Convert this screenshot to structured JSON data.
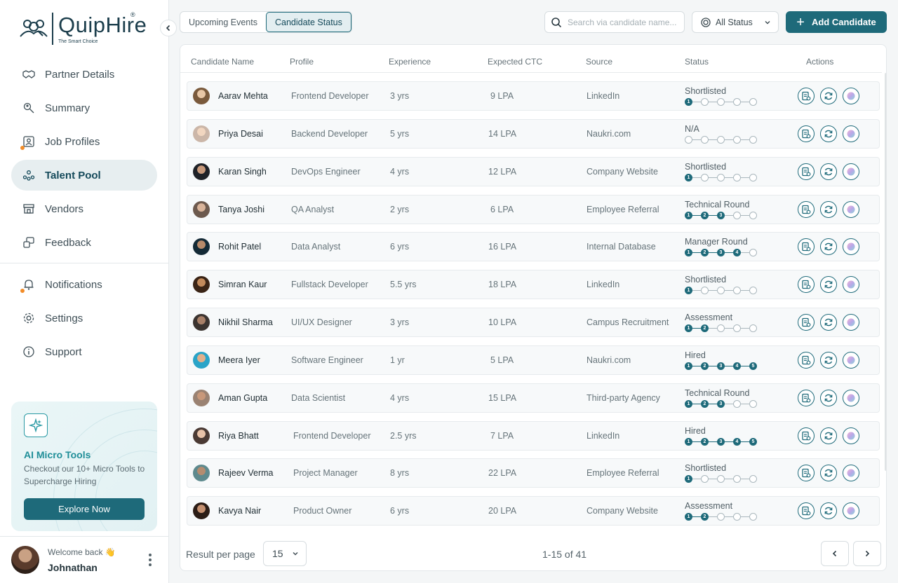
{
  "brand": {
    "name": "QuipHire",
    "tagline": "The Smart Choice",
    "reg": "®"
  },
  "nav_primary": [
    {
      "label": "Partner Details",
      "icon": "handshake-icon"
    },
    {
      "label": "Summary",
      "icon": "summary-icon"
    },
    {
      "label": "Job Profiles",
      "icon": "job-profile-icon",
      "badge": true
    },
    {
      "label": "Talent Pool",
      "icon": "talent-pool-icon",
      "active": true
    },
    {
      "label": "Vendors",
      "icon": "store-icon"
    },
    {
      "label": "Feedback",
      "icon": "feedback-icon"
    }
  ],
  "nav_secondary": [
    {
      "label": "Notifications",
      "icon": "bell-icon",
      "badge": true
    },
    {
      "label": "Settings",
      "icon": "gear-icon"
    },
    {
      "label": "Support",
      "icon": "info-icon"
    }
  ],
  "promo": {
    "title": "AI Micro Tools",
    "description": "Checkout our 10+ Micro Tools to Supercharge Hiring",
    "button": "Explore Now"
  },
  "user": {
    "welcome": "Welcome back 👋",
    "name": "Johnathan"
  },
  "tabs": [
    {
      "label": "Upcoming Events",
      "active": false
    },
    {
      "label": "Candidate Status",
      "active": true
    }
  ],
  "search": {
    "placeholder": "Search via candidate name..."
  },
  "status_filter": {
    "label": "All Status"
  },
  "add_button": "Add Candidate",
  "table": {
    "headers": [
      "Candidate Name",
      "Profile",
      "Experience",
      "Expected CTC",
      "Source",
      "Status",
      "Actions"
    ],
    "rows": [
      {
        "name": "Aarav Mehta",
        "profile": "Frontend Developer",
        "experience": "3 yrs",
        "ctc": "9 LPA",
        "source": "LinkedIn",
        "status": "Shortlisted",
        "stage": 1
      },
      {
        "name": "Priya Desai",
        "profile": "Backend Developer",
        "experience": "5 yrs",
        "ctc": "14 LPA",
        "source": "Naukri.com",
        "status": "N/A",
        "stage": 0
      },
      {
        "name": "Karan Singh",
        "profile": "DevOps Engineer",
        "experience": "4 yrs",
        "ctc": "12 LPA",
        "source": "Company Website",
        "status": "Shortlisted",
        "stage": 1
      },
      {
        "name": "Tanya Joshi",
        "profile": "QA Analyst",
        "experience": "2 yrs",
        "ctc": "6 LPA",
        "source": "Employee Referral",
        "status": "Technical Round",
        "stage": 3
      },
      {
        "name": "Rohit Patel",
        "profile": "Data Analyst",
        "experience": "6 yrs",
        "ctc": "16 LPA",
        "source": "Internal Database",
        "status": "Manager Round",
        "stage": 4
      },
      {
        "name": "Simran Kaur",
        "profile": "Fullstack Developer",
        "experience": "5.5 yrs",
        "ctc": "18 LPA",
        "source": "LinkedIn",
        "status": "Shortlisted",
        "stage": 1
      },
      {
        "name": "Nikhil Sharma",
        "profile": "UI/UX Designer",
        "experience": "3 yrs",
        "ctc": "10 LPA",
        "source": "Campus Recruitment",
        "status": "Assessment",
        "stage": 2
      },
      {
        "name": "Meera Iyer",
        "profile": "Software Engineer",
        "experience": "1 yr",
        "ctc": "5 LPA",
        "source": "Naukri.com",
        "status": "Hired",
        "stage": 5
      },
      {
        "name": "Aman Gupta",
        "profile": "Data Scientist",
        "experience": "4 yrs",
        "ctc": "15 LPA",
        "source": "Third-party Agency",
        "status": "Technical Round",
        "stage": 3
      },
      {
        "name": "Riya Bhatt",
        "profile": "Frontend Developer",
        "experience": "2.5 yrs",
        "ctc": "7 LPA",
        "source": "LinkedIn",
        "status": "Hired",
        "stage": 5
      },
      {
        "name": "Rajeev Verma",
        "profile": "Project Manager",
        "experience": "8 yrs",
        "ctc": "22 LPA",
        "source": "Employee Referral",
        "status": "Shortlisted",
        "stage": 1
      },
      {
        "name": "Kavya Nair",
        "profile": "Product Owner",
        "experience": "6 yrs",
        "ctc": "20 LPA",
        "source": "Company Website",
        "status": "Assessment",
        "stage": 2
      }
    ]
  },
  "pagination": {
    "label": "Result per page",
    "per_page": "15",
    "range": "1-15 of 41"
  },
  "colors": {
    "accent": "#1e6a7a",
    "active_nav_bg": "#e7eef0",
    "badge": "#f28c28"
  }
}
